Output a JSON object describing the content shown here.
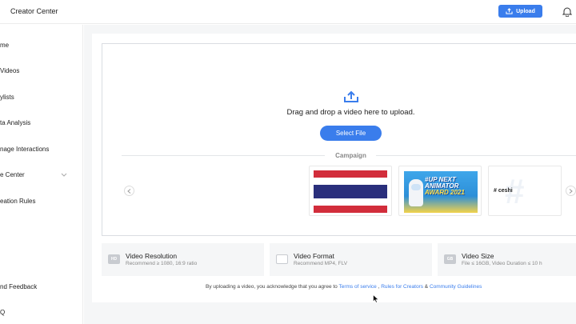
{
  "header": {
    "title": "Creator Center",
    "upload_label": "Upload",
    "upload_icon": "cloud-upload-icon",
    "notification_icon": "bell-icon"
  },
  "sidebar": {
    "items": [
      {
        "label": "me"
      },
      {
        "label": " Videos"
      },
      {
        "label": "ylists"
      },
      {
        "label": "ta Analysis"
      },
      {
        "label": "nage Interactions"
      },
      {
        "label": "e Center"
      },
      {
        "label": "eation Rules"
      },
      {
        "label": "nd Feedback"
      },
      {
        "label": "Q"
      }
    ]
  },
  "upload": {
    "icon": "upload-icon",
    "instruction": "Drag and drop a video here to upload.",
    "select_label": "Select File"
  },
  "campaign": {
    "label": "Campaign",
    "cards": [
      {
        "name": "thailand-flag"
      },
      {
        "name": "animator-award",
        "line1": "#UP NEXT",
        "line2": "ANIMATOR",
        "line3": "AWARD 2021"
      },
      {
        "name": "ceshi",
        "text": "# ceshi",
        "bg_text": "#"
      }
    ]
  },
  "requirements": [
    {
      "badge": "HD",
      "title": "Video Resolution",
      "sub": "Recommend ≥ 1080, 16:9 ratio"
    },
    {
      "badge": "",
      "title": "Video Format",
      "sub": "Recommend MP4, FLV"
    },
    {
      "badge": "GB",
      "title": "Video Size",
      "sub": "File ≤ 16GB, Video Duration ≤ 10 h"
    }
  ],
  "agreement": {
    "prefix": "By uploading a video, you acknowledge that you agree to ",
    "terms": "Terms of service",
    "sep1": " , ",
    "rules": "Rules for Creators",
    "sep2": " & ",
    "guidelines": "Community Guidelines"
  },
  "colors": {
    "accent": "#3a7dec",
    "background": "#f5f6f7"
  }
}
